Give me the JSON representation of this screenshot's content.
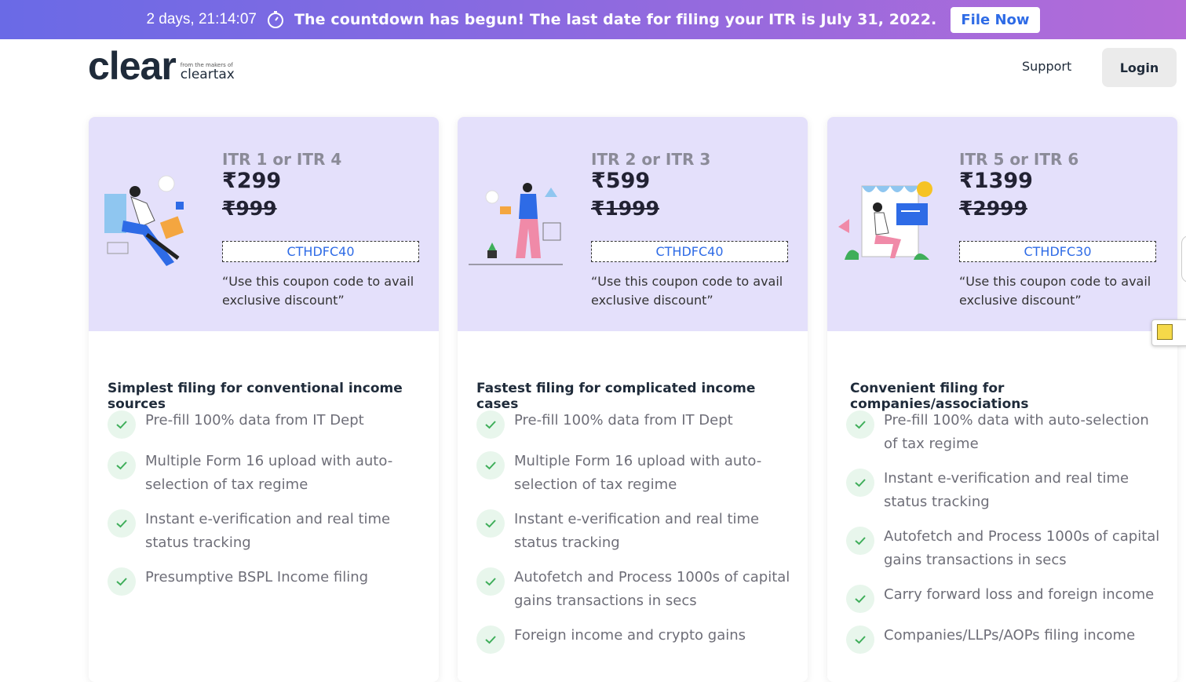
{
  "banner": {
    "countdown": "2 days, 21:14:07",
    "message": "The countdown has begun! The last date for filing your ITR is July 31, 2022.",
    "cta_label": "File Now",
    "clock_icon": "stopwatch-icon"
  },
  "header": {
    "logo_word": "clear",
    "logo_small": "from the makers of",
    "logo_brand": "cleartax",
    "support_label": "Support",
    "login_label": "Login"
  },
  "cards": [
    {
      "itr": "ITR 1 or ITR 4",
      "price": "₹299",
      "old_price": "₹999",
      "coupon": "CTHDFC40",
      "coupon_note": "“Use this coupon code to avail exclusive discount”",
      "heading": "Simplest filing for conventional income sources",
      "features": [
        "Pre-fill 100% data from IT Dept",
        "Multiple Form 16 upload with auto-selection of tax regime",
        "Instant e-verification and real time status tracking",
        "Presumptive BSPL Income filing"
      ]
    },
    {
      "itr": "ITR 2 or ITR 3",
      "price": "₹599",
      "old_price": "₹1999",
      "coupon": "CTHDFC40",
      "coupon_note": "“Use this coupon code to avail exclusive discount”",
      "heading": "Fastest filing for complicated income cases",
      "features": [
        "Pre-fill 100% data from IT Dept",
        "Multiple Form 16 upload with auto-selection of tax regime",
        "Instant e-verification and real time status tracking",
        "Autofetch and Process 1000s of capital gains transactions in secs",
        "Foreign income and crypto gains"
      ]
    },
    {
      "itr": "ITR 5 or ITR 6",
      "price": "₹1399",
      "old_price": "₹2999",
      "coupon": "CTHDFC30",
      "coupon_note": "“Use this coupon code to avail exclusive discount”",
      "heading": "Convenient filing for companies/associations",
      "features": [
        "Pre-fill 100% data with auto-selection of tax regime",
        "Instant e-verification and real time status tracking",
        "Autofetch and Process 1000s of capital gains transactions in secs",
        "Carry forward loss and foreign income",
        "Companies/LLPs/AOPs filing income"
      ]
    }
  ],
  "colors": {
    "banner_start": "#6a6ae6",
    "banner_end": "#b46bd8",
    "card_top": "#e4e0fb",
    "coupon_text": "#2e6be6",
    "check_green": "#3fae5a"
  }
}
